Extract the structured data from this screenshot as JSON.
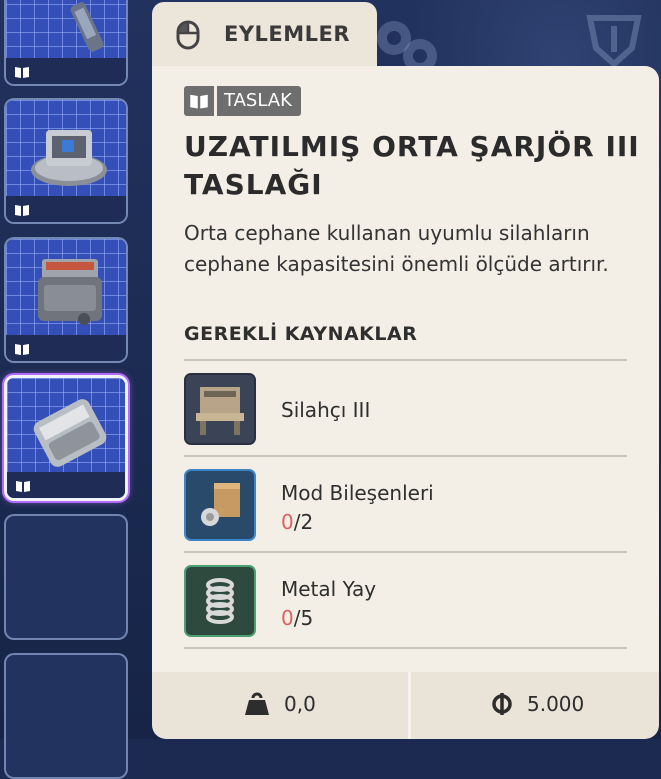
{
  "tab": {
    "label": "EYLEMLER",
    "icon": "mouse-icon"
  },
  "badge": {
    "label": "TASLAK",
    "icon": "book-icon"
  },
  "item": {
    "title": "UZATILMIŞ ORTA ŞARJÖR III TASLAĞI",
    "description": "Orta cephane kullanan uyumlu silahların cephane kapasitesini önemli ölçüde artırır."
  },
  "requirements": {
    "heading": "GEREKLİ KAYNAKLAR",
    "items": [
      {
        "name": "Silahçı III",
        "icon": "workbench-icon"
      },
      {
        "name": "Mod Bileşenleri",
        "have": "0",
        "need": "/2",
        "icon": "mod-components-icon"
      },
      {
        "name": "Metal Yay",
        "have": "0",
        "need": "/5",
        "icon": "metal-spring-icon"
      }
    ]
  },
  "footer": {
    "weight": {
      "icon": "weight-icon",
      "value": "0,0"
    },
    "price": {
      "icon": "coin-icon",
      "value": "5.000"
    }
  },
  "inventory": {
    "slots": [
      {
        "icon": "blueprint-part-icon",
        "state": "filled"
      },
      {
        "icon": "blueprint-device-icon",
        "state": "filled"
      },
      {
        "icon": "blueprint-magazine-icon",
        "state": "filled"
      },
      {
        "icon": "blueprint-extended-magazine-icon",
        "state": "selected"
      },
      {
        "state": "empty"
      },
      {
        "state": "empty"
      }
    ]
  },
  "colors": {
    "background": "#1c2a52",
    "panel": "#f3efe6",
    "missing_count": "#e06060",
    "selected_glow": "#b36bff"
  }
}
